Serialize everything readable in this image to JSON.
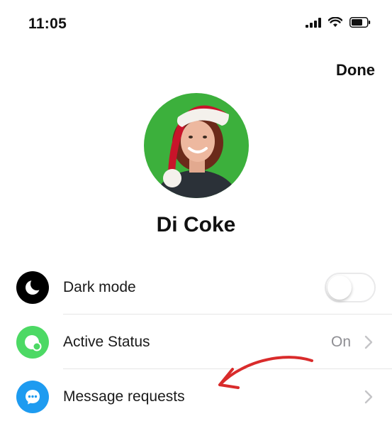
{
  "status_bar": {
    "time": "11:05",
    "icons": [
      "signal-icon",
      "wifi-icon",
      "battery-icon"
    ]
  },
  "header": {
    "done_label": "Done"
  },
  "profile": {
    "name": "Di Coke"
  },
  "settings": [
    {
      "label": "Dark mode",
      "icon": "moon-icon",
      "icon_bg": "#000000",
      "control": "toggle",
      "toggle_on": false
    },
    {
      "label": "Active Status",
      "icon": "active-status-icon",
      "icon_bg": "#4CD964",
      "value": "On",
      "control": "chevron"
    },
    {
      "label": "Message requests",
      "icon": "chat-bubble-icon",
      "icon_bg": "#1E9BF0",
      "control": "chevron"
    }
  ],
  "colors": {
    "annotation_arrow": "#D92B2B",
    "avatar_bg": "#3CB03C"
  }
}
